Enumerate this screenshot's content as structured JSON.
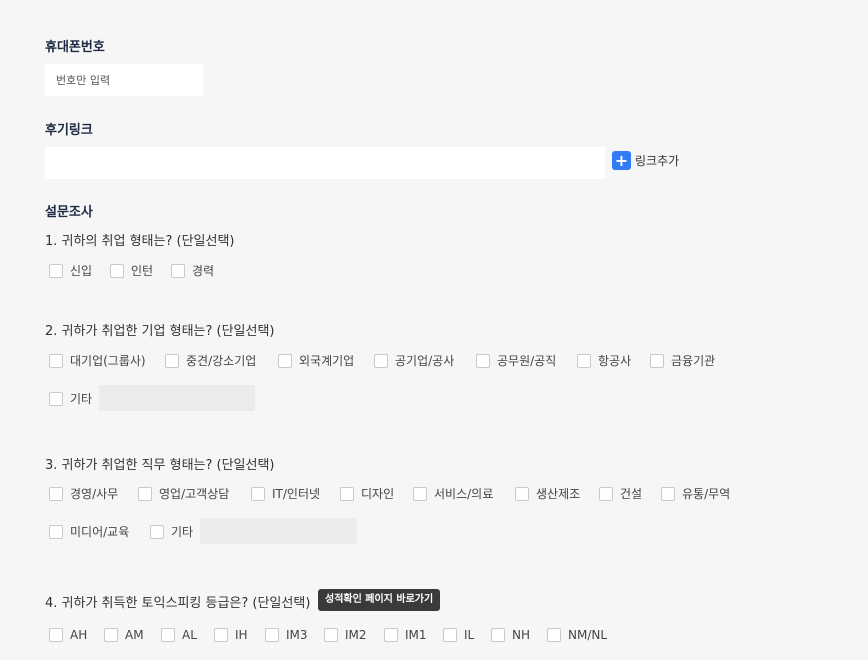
{
  "phone": {
    "label": "휴대폰번호",
    "placeholder": "번호만 입력"
  },
  "review": {
    "label": "후기링크",
    "value": "",
    "add_label": "링크추가"
  },
  "survey": {
    "title": "설문조사",
    "q1": {
      "title": "1. 귀하의 취업 형태는? (단일선택)",
      "options": [
        "신입",
        "인턴",
        "경력"
      ]
    },
    "q2": {
      "title": "2. 귀하가 취업한 기업 형태는? (단일선택)",
      "options": [
        "대기업(그룹사)",
        "중견/강소기업",
        "외국계기업",
        "공기업/공사",
        "공무원/공직",
        "항공사",
        "금융기관",
        "기타"
      ]
    },
    "q3": {
      "title": "3. 귀하가 취업한 직무 형태는? (단일선택)",
      "options": [
        "경영/사무",
        "영업/고객상담",
        "IT/인터넷",
        "디자인",
        "서비스/의료",
        "생산제조",
        "건설",
        "유통/무역",
        "미디어/교육",
        "기타"
      ]
    },
    "q4": {
      "title": "4. 귀하가 취득한 토익스피킹 등급은? (단일선택)",
      "badge": "성적확인 페이지 바로가기",
      "options": [
        "AH",
        "AM",
        "AL",
        "IH",
        "IM3",
        "IM2",
        "IM1",
        "IL",
        "NH",
        "NM/NL"
      ]
    }
  }
}
